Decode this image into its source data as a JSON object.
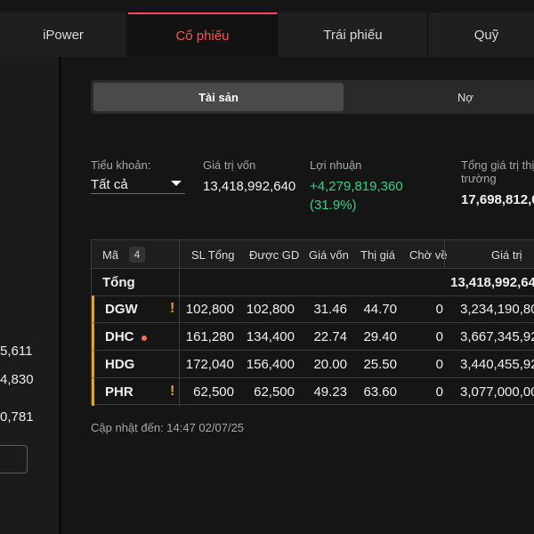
{
  "tabs": [
    "iPower",
    "Cổ phiếu",
    "Trái phiếu",
    "Quỹ"
  ],
  "left_values": [
    "5,611",
    "4,830",
    "0,781"
  ],
  "segment": {
    "assets": "Tài sản",
    "debt": "Nợ"
  },
  "summary": {
    "account_label": "Tiểu khoản:",
    "account_value": "Tất cả",
    "capital_label": "Giá trị vốn",
    "capital_value": "13,418,992,640",
    "profit_label": "Lợi nhuận",
    "profit_value": "+4,279,819,360",
    "profit_pct": "(31.9%)",
    "total_label_1": "Tổng giá trị thị",
    "total_label_2": "trường",
    "total_value": "17,698,812,0"
  },
  "table": {
    "headers": [
      "Mã",
      "SL Tổng",
      "Được GD",
      "Giá vốn",
      "Thị giá",
      "Chờ về",
      "Giá trị"
    ],
    "count": "4",
    "total_label": "Tổng",
    "total_value": "13,418,992,64",
    "rows": [
      {
        "ticker": "DGW",
        "total_qty": "102,800",
        "tradable": "102,800",
        "cost": "31.46",
        "market": "44.70",
        "pending": "0",
        "value": "3,234,190,80"
      },
      {
        "ticker": "DHC",
        "total_qty": "161,280",
        "tradable": "134,400",
        "cost": "22.74",
        "market": "29.40",
        "pending": "0",
        "value": "3,667,345,92"
      },
      {
        "ticker": "HDG",
        "total_qty": "172,040",
        "tradable": "156,400",
        "cost": "20.00",
        "market": "25.50",
        "pending": "0",
        "value": "3,440,455,92"
      },
      {
        "ticker": "PHR",
        "total_qty": "62,500",
        "tradable": "62,500",
        "cost": "49.23",
        "market": "63.60",
        "pending": "0",
        "value": "3,077,000,00"
      }
    ]
  },
  "updated": "Cập nhật đến: 14:47 02/07/25",
  "colors": {
    "accent": "#ff4b55",
    "positive": "#2bd48a",
    "warning": "#e8a317"
  }
}
